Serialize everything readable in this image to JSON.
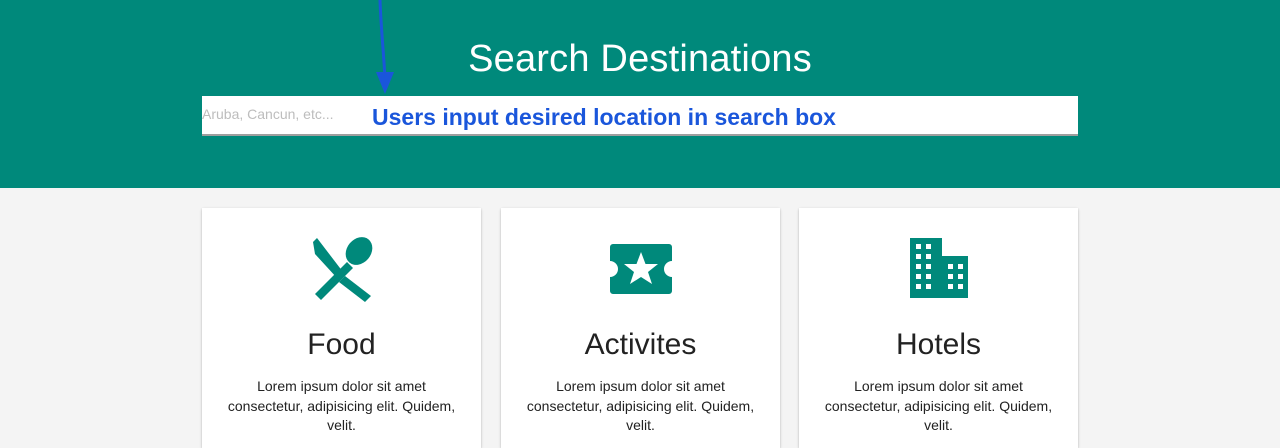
{
  "header": {
    "title": "Search Destinations",
    "search_placeholder": "Aruba, Cancun, etc...",
    "background_color": "#00897b"
  },
  "annotation": {
    "text": "Users input desired location in search box",
    "color": "#1a56db"
  },
  "cards": [
    {
      "icon": "restaurant-icon",
      "title": "Food",
      "text": "Lorem ipsum dolor sit amet consectetur, adipisicing elit. Quidem, velit."
    },
    {
      "icon": "ticket-star-icon",
      "title": "Activites",
      "text": "Lorem ipsum dolor sit amet consectetur, adipisicing elit. Quidem, velit."
    },
    {
      "icon": "hotel-building-icon",
      "title": "Hotels",
      "text": "Lorem ipsum dolor sit amet consectetur, adipisicing elit. Quidem, velit."
    }
  ],
  "colors": {
    "accent": "#00897b",
    "page_background": "#f4f4f4"
  }
}
